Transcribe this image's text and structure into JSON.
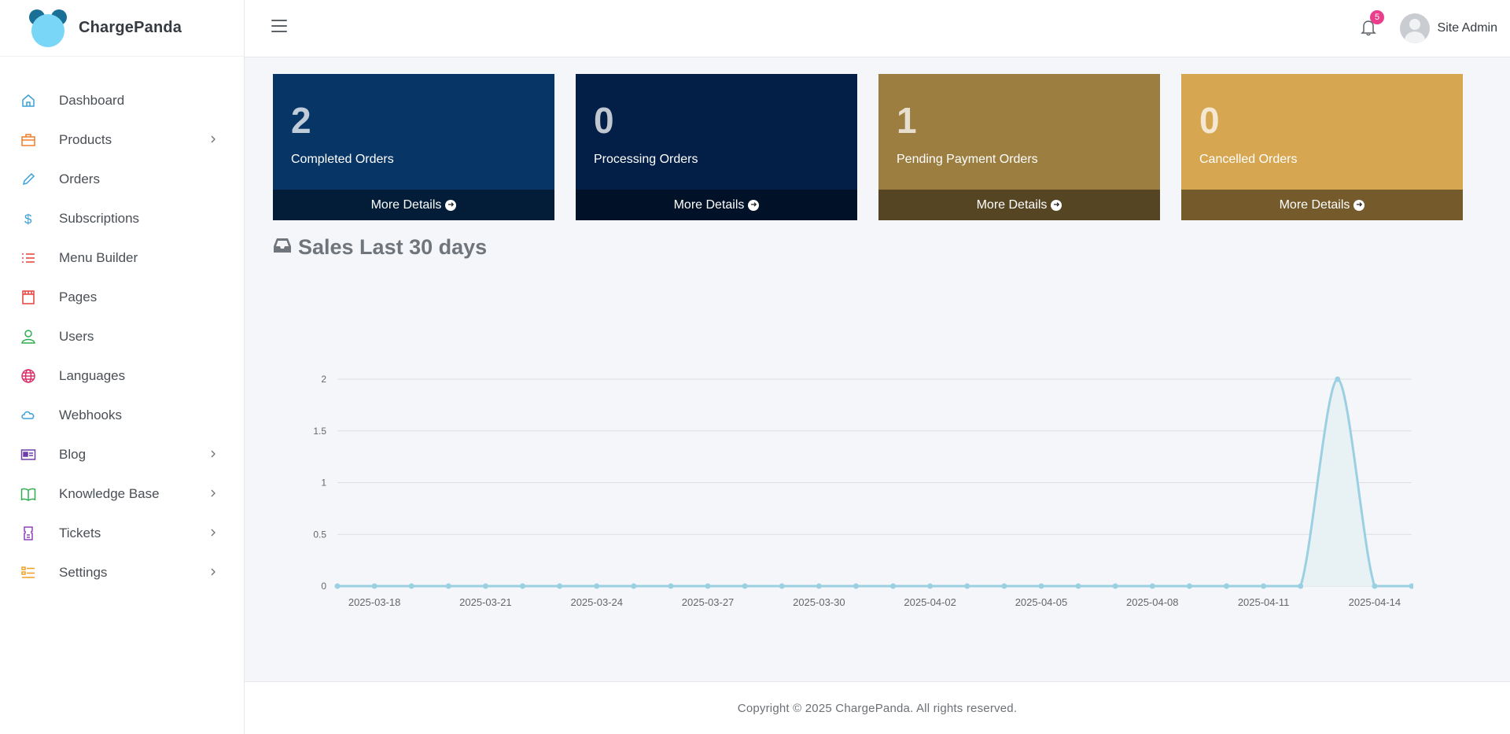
{
  "brand": {
    "name": "ChargePanda"
  },
  "sidebar": {
    "items": [
      {
        "label": "Dashboard",
        "icon": "home-icon",
        "color": "#3aa0d8",
        "has_children": false
      },
      {
        "label": "Products",
        "icon": "briefcase-icon",
        "color": "#f07d2a",
        "has_children": true
      },
      {
        "label": "Orders",
        "icon": "pencil-icon",
        "color": "#3aa0d8",
        "has_children": false
      },
      {
        "label": "Subscriptions",
        "icon": "dollar-icon",
        "color": "#3aa0d8",
        "has_children": false
      },
      {
        "label": "Menu Builder",
        "icon": "list-icon",
        "color": "#e8413c",
        "has_children": false
      },
      {
        "label": "Pages",
        "icon": "page-icon",
        "color": "#e8413c",
        "has_children": false
      },
      {
        "label": "Users",
        "icon": "user-icon",
        "color": "#2fae4f",
        "has_children": false
      },
      {
        "label": "Languages",
        "icon": "globe-icon",
        "color": "#d9316b",
        "has_children": false
      },
      {
        "label": "Webhooks",
        "icon": "cloud-icon",
        "color": "#3aa0d8",
        "has_children": false
      },
      {
        "label": "Blog",
        "icon": "id-card-icon",
        "color": "#6f3fa8",
        "has_children": true
      },
      {
        "label": "Knowledge Base",
        "icon": "book-icon",
        "color": "#2fae4f",
        "has_children": true
      },
      {
        "label": "Tickets",
        "icon": "ticket-icon",
        "color": "#8f44b8",
        "has_children": true
      },
      {
        "label": "Settings",
        "icon": "settings-list-icon",
        "color": "#f0a020",
        "has_children": true
      }
    ]
  },
  "header": {
    "notifications_count": "5",
    "user_name": "Site Admin"
  },
  "boxes": [
    {
      "number": "2",
      "label": "Completed Orders",
      "link": "More Details",
      "color": "#063566"
    },
    {
      "number": "0",
      "label": "Processing Orders",
      "link": "More Details",
      "color": "#031f47"
    },
    {
      "number": "1",
      "label": "Pending Payment Orders",
      "link": "More Details",
      "color": "#9c7e40"
    },
    {
      "number": "0",
      "label": "Cancelled Orders",
      "link": "More Details",
      "color": "#d6a650"
    }
  ],
  "sales": {
    "title": "Sales Last 30 days"
  },
  "chart_data": {
    "type": "area",
    "title": "Sales Last 30 days",
    "x": [
      "2025-03-17",
      "2025-03-18",
      "2025-03-19",
      "2025-03-20",
      "2025-03-21",
      "2025-03-22",
      "2025-03-23",
      "2025-03-24",
      "2025-03-25",
      "2025-03-26",
      "2025-03-27",
      "2025-03-28",
      "2025-03-29",
      "2025-03-30",
      "2025-03-31",
      "2025-04-01",
      "2025-04-02",
      "2025-04-03",
      "2025-04-04",
      "2025-04-05",
      "2025-04-06",
      "2025-04-07",
      "2025-04-08",
      "2025-04-09",
      "2025-04-10",
      "2025-04-11",
      "2025-04-12",
      "2025-04-13",
      "2025-04-14",
      "2025-04-15"
    ],
    "x_tick_labels": [
      "2025-03-18",
      "2025-03-21",
      "2025-03-24",
      "2025-03-27",
      "2025-03-30",
      "2025-04-02",
      "2025-04-05",
      "2025-04-08",
      "2025-04-11",
      "2025-04-14"
    ],
    "values": [
      0,
      0,
      0,
      0,
      0,
      0,
      0,
      0,
      0,
      0,
      0,
      0,
      0,
      0,
      0,
      0,
      0,
      0,
      0,
      0,
      0,
      0,
      0,
      0,
      0,
      0,
      0,
      2,
      0,
      0
    ],
    "ylim": [
      0,
      2
    ],
    "y_ticks": [
      "0",
      "0.5",
      "1",
      "1.5",
      "2"
    ],
    "grid": true,
    "line_color": "#9bd0e3",
    "fill_color": "#e8f2f5"
  },
  "footer": {
    "text": "Copyright © 2025 ChargePanda. All rights reserved."
  }
}
